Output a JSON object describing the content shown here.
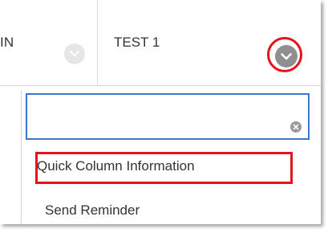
{
  "columns": {
    "previous_label": "IN",
    "active_label": "TEST 1"
  },
  "dropdown": {
    "search_value": "",
    "items": [
      "Quick Column Information",
      "Send Reminder"
    ]
  },
  "icons": {
    "previous_chevron": "chevron-down-icon",
    "active_chevron": "chevron-down-icon",
    "clear": "clear-icon"
  },
  "colors": {
    "highlight": "#e3141c",
    "focus_border": "#3a78c9",
    "chevron_active": "#8f8f8f",
    "chevron_inactive": "#e6e6e6"
  }
}
